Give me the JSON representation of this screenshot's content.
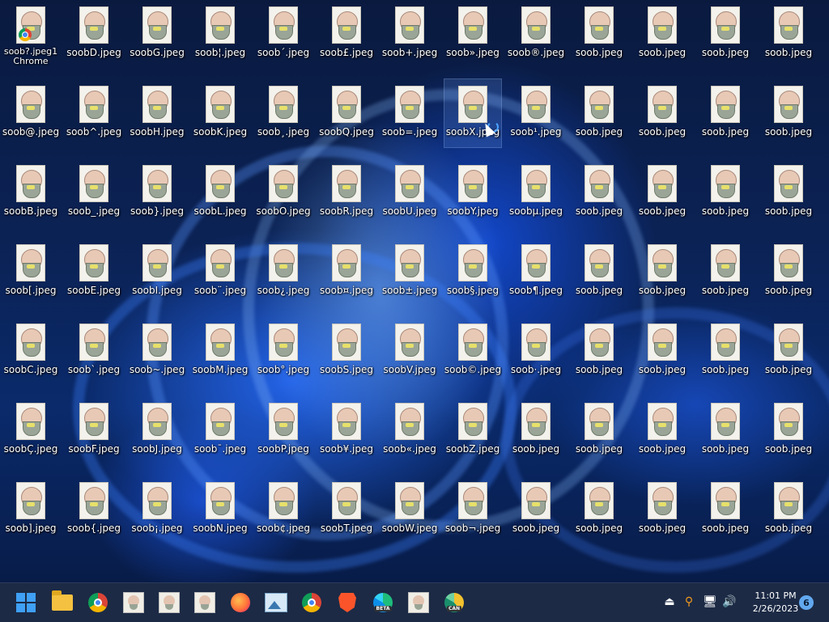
{
  "desktop": {
    "top_left_icon": {
      "label_line1": "soob?.jpeg1",
      "label_line2": "Chrome"
    },
    "columns": [
      [
        "",
        "soob@.jpeg",
        "soobB.jpeg",
        "soob[.jpeg",
        "soobC.jpeg",
        "soobÇ.jpeg",
        "soob].jpeg"
      ],
      [
        "soobD.jpeg",
        "soob^.jpeg",
        "soob_.jpeg",
        "soobE.jpeg",
        "soob`.jpeg",
        "soobF.jpeg",
        "soob{.jpeg"
      ],
      [
        "soobG.jpeg",
        "soobH.jpeg",
        "soob}.jpeg",
        "soobI.jpeg",
        "soob~.jpeg",
        "soobJ.jpeg",
        "soob¡.jpeg"
      ],
      [
        "soob¦.jpeg",
        "soobK.jpeg",
        "soobL.jpeg",
        "soob¨.jpeg",
        "soobM.jpeg",
        "soob¯.jpeg",
        "soobN.jpeg"
      ],
      [
        "soob´.jpeg",
        "soob¸.jpeg",
        "soobO.jpeg",
        "soob¿.jpeg",
        "soob°.jpeg",
        "soobP.jpeg",
        "soob¢.jpeg"
      ],
      [
        "soob£.jpeg",
        "soobQ.jpeg",
        "soobR.jpeg",
        "soob¤.jpeg",
        "soobS.jpeg",
        "soob¥.jpeg",
        "soobT.jpeg"
      ],
      [
        "soob+.jpeg",
        "soob=.jpeg",
        "soobU.jpeg",
        "soob±.jpeg",
        "soobV.jpeg",
        "soob«.jpeg",
        "soobW.jpeg"
      ],
      [
        "soob».jpeg",
        "soobX.jpeg",
        "soobY.jpeg",
        "soob§.jpeg",
        "soob©.jpeg",
        "soobZ.jpeg",
        "soob¬.jpeg"
      ],
      [
        "soob®.jpeg",
        "soob¹.jpeg",
        "soobµ.jpeg",
        "soob¶.jpeg",
        "soob·.jpeg",
        "soob.jpeg",
        "soob.jpeg"
      ],
      [
        "soob.jpeg",
        "soob.jpeg",
        "soob.jpeg",
        "soob.jpeg",
        "soob.jpeg",
        "soob.jpeg",
        "soob.jpeg"
      ],
      [
        "soob.jpeg",
        "soob.jpeg",
        "soob.jpeg",
        "soob.jpeg",
        "soob.jpeg",
        "soob.jpeg",
        "soob.jpeg"
      ],
      [
        "soob.jpeg",
        "soob.jpeg",
        "soob.jpeg",
        "soob.jpeg",
        "soob.jpeg",
        "soob.jpeg",
        "soob.jpeg"
      ],
      [
        "soob.jpeg",
        "soob.jpeg",
        "soob.jpeg",
        "soob.jpeg",
        "soob.jpeg",
        "soob.jpeg",
        "soob.jpeg"
      ]
    ],
    "selected_label": "soobX.jpeg"
  },
  "taskbar": {
    "apps": [
      {
        "name": "start",
        "icon": "windows-logo-icon"
      },
      {
        "name": "file-explorer",
        "icon": "folder-icon"
      },
      {
        "name": "chrome",
        "icon": "chrome-icon"
      },
      {
        "name": "image-1",
        "icon": "image-thumb-icon"
      },
      {
        "name": "image-2",
        "icon": "image-thumb-icon"
      },
      {
        "name": "image-3",
        "icon": "image-thumb-icon"
      },
      {
        "name": "firefox",
        "icon": "firefox-icon"
      },
      {
        "name": "photos",
        "icon": "photos-icon"
      },
      {
        "name": "chrome-2",
        "icon": "chrome-icon"
      },
      {
        "name": "brave",
        "icon": "brave-icon"
      },
      {
        "name": "edge-beta",
        "icon": "edge-icon",
        "tag": "BETA"
      },
      {
        "name": "image-4",
        "icon": "image-thumb-icon"
      },
      {
        "name": "edge-canary",
        "icon": "edge-icon",
        "tag": "CAN"
      }
    ],
    "tray": {
      "time": "11:01 PM",
      "date": "2/26/2023",
      "notification_count": "6"
    }
  }
}
